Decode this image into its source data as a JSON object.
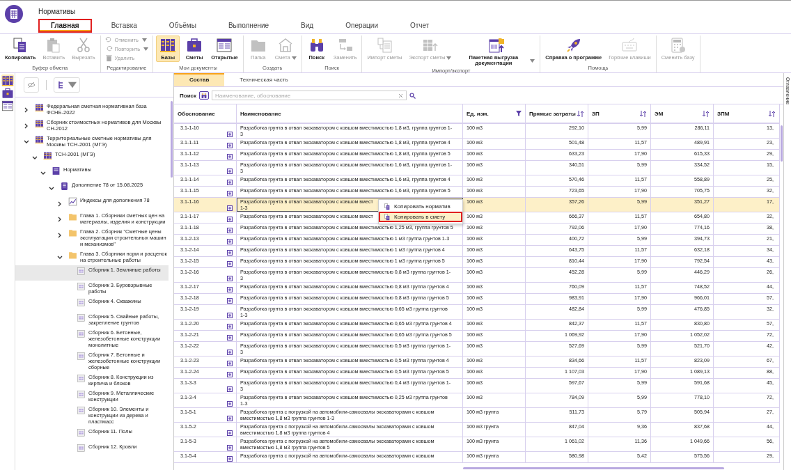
{
  "window": {
    "title": "Нормативы"
  },
  "tabs": [
    {
      "label": "Главная",
      "selected": true
    },
    {
      "label": "Вставка",
      "selected": false
    },
    {
      "label": "Объёмы",
      "selected": false
    },
    {
      "label": "Выполнение",
      "selected": false
    },
    {
      "label": "Вид",
      "selected": false
    },
    {
      "label": "Операции",
      "selected": false
    },
    {
      "label": "Отчет",
      "selected": false
    }
  ],
  "ribbon": [
    {
      "label": "Буфер обмена",
      "items": [
        {
          "label": "Копировать",
          "kind": "large",
          "disabled": false
        },
        {
          "label": "Вставить",
          "kind": "large",
          "disabled": true
        },
        {
          "label": "Вырезать",
          "kind": "large",
          "disabled": true
        }
      ]
    },
    {
      "label": "Редактирование",
      "items": [
        {
          "label": "Отменить",
          "kind": "small",
          "disabled": true,
          "dropdown": true
        },
        {
          "label": "Повторить",
          "kind": "small",
          "disabled": true,
          "dropdown": true
        },
        {
          "label": "Удалить",
          "kind": "small",
          "disabled": true
        }
      ]
    },
    {
      "label": "Мои документы",
      "items": [
        {
          "label": "Базы",
          "kind": "large",
          "disabled": false,
          "selected": true
        },
        {
          "label": "Сметы",
          "kind": "large",
          "disabled": false,
          "selected": false
        },
        {
          "label": "Открытые",
          "kind": "large",
          "disabled": false,
          "selected": false
        }
      ]
    },
    {
      "label": "Создать",
      "items": [
        {
          "label": "Папка",
          "kind": "large",
          "disabled": true
        },
        {
          "label": "Смета",
          "kind": "large",
          "disabled": true,
          "dropdown": true
        }
      ]
    },
    {
      "label": "Поиск",
      "items": [
        {
          "label": "Поиск",
          "kind": "large",
          "disabled": false
        },
        {
          "label": "Заменить",
          "kind": "large",
          "disabled": true
        }
      ]
    },
    {
      "label": "Импорт/экспорт",
      "items": [
        {
          "label": "Импорт сметы",
          "kind": "large",
          "disabled": true
        },
        {
          "label": "Экспорт сметы",
          "kind": "large",
          "disabled": true,
          "dropdown": true
        },
        {
          "label": "Пакетная выгрузка документации",
          "kind": "large",
          "disabled": false,
          "dropdown": true
        }
      ]
    },
    {
      "label": "Помощь",
      "items": [
        {
          "label": "Справка о программе",
          "kind": "large",
          "disabled": false
        },
        {
          "label": "Горячие клавиши",
          "kind": "large",
          "disabled": true
        }
      ]
    },
    {
      "items": [
        {
          "label": "Сменить базу",
          "kind": "large",
          "disabled": true
        }
      ]
    }
  ],
  "side_strip": [
    {
      "selected": true
    },
    {
      "selected": false
    },
    {
      "selected": false
    }
  ],
  "tree": [
    {
      "label": "Федеральная сметная нормативная база ФСНБ-2022",
      "kind": "base",
      "expanded": false,
      "selected": false
    },
    {
      "label": "Сборник стоимостных нормативов для Москвы СН-2012",
      "kind": "base",
      "expanded": false,
      "selected": false
    },
    {
      "label": "Территориальные сметные нормативы для Москвы ТСН-2001 (МГЭ)",
      "kind": "base",
      "expanded": true,
      "selected": false,
      "children": [
        {
          "label": "ТСН-2001 (МГЭ)",
          "kind": "base",
          "expanded": true,
          "selected": false,
          "children": [
            {
              "label": "Нормативы",
              "kind": "norms",
              "expanded": true,
              "selected": false,
              "children": [
                {
                  "label": "Дополнение 78 от 15.08.2025",
                  "kind": "book",
                  "expanded": true,
                  "selected": false,
                  "children": [
                    {
                      "label": "Индексы для дополнения 78",
                      "kind": "chart",
                      "expanded": false,
                      "selected": false
                    },
                    {
                      "label": "Глава 1. Сборники сметных цен на материалы, изделия и конструкции",
                      "kind": "folder",
                      "expanded": false,
                      "selected": false
                    },
                    {
                      "label": "Глава 2. Сборник \"Сметные цены эксплуатации строительных машин и механизмов\"",
                      "kind": "folder",
                      "expanded": false,
                      "selected": false
                    },
                    {
                      "label": "Глава 3. Сборники норм и расценок на строительные работы",
                      "kind": "folder",
                      "expanded": true,
                      "selected": false,
                      "children": [
                        {
                          "label": "Сборник 1. Земляные работы",
                          "kind": "collection",
                          "selected": true
                        },
                        {
                          "label": "Сборник 3. Буровзрывные работы",
                          "kind": "collection",
                          "selected": false
                        },
                        {
                          "label": "Сборник 4. Скважины",
                          "kind": "collection",
                          "selected": false
                        },
                        {
                          "label": "Сборник 5. Свайные работы, закрепление грунтов",
                          "kind": "collection",
                          "selected": false
                        },
                        {
                          "label": "Сборник 6. Бетонные, железобетонные конструкции монолитные",
                          "kind": "collection",
                          "selected": false
                        },
                        {
                          "label": "Сборник 7. Бетонные и железобетонные конструкции сборные",
                          "kind": "collection",
                          "selected": false
                        },
                        {
                          "label": "Сборник 8. Конструкции из кирпича и блоков",
                          "kind": "collection",
                          "selected": false
                        },
                        {
                          "label": "Сборник 9. Металлические конструкции",
                          "kind": "collection",
                          "selected": false
                        },
                        {
                          "label": "Сборник 10. Элементы и конструкции из дерева и пластмасс",
                          "kind": "collection",
                          "selected": false
                        },
                        {
                          "label": "Сборник 11. Полы",
                          "kind": "collection",
                          "selected": false
                        },
                        {
                          "label": "Сборник 12. Кровли",
                          "kind": "collection",
                          "selected": false
                        }
                      ]
                    }
                  ]
                }
              ]
            }
          ]
        }
      ]
    }
  ],
  "content_tabs": [
    {
      "label": "Состав",
      "selected": true
    },
    {
      "label": "Техническая часть",
      "selected": false
    }
  ],
  "search": {
    "label": "Поиск",
    "placeholder": "Наименование, обоснование"
  },
  "right_tab": {
    "label": "Оглавление"
  },
  "table": {
    "columns": [
      {
        "label": "Обоснование",
        "sortable": false,
        "filtered": false
      },
      {
        "label": "Наименование",
        "sortable": false,
        "filtered": false
      },
      {
        "label": "Ед. изм.",
        "sortable": false,
        "filtered": true
      },
      {
        "label": "Прямые затраты",
        "sortable": true,
        "filtered": false
      },
      {
        "label": "ЗП",
        "sortable": true,
        "filtered": false
      },
      {
        "label": "ЭМ",
        "sortable": true,
        "filtered": false
      },
      {
        "label": "ЗПМ",
        "sortable": true,
        "filtered": false
      }
    ],
    "rows": [
      {
        "cells": [
          "3.1-1-10",
          "Разработка грунта в отвал экскаватором с ковшом вместимостью 1,8 м3, группа грунтов 1-3",
          "100 м3",
          "292,10",
          "5,99",
          "286,11",
          "13,"
        ],
        "selected": false
      },
      {
        "cells": [
          "3.1-1-11",
          "Разработка грунта в отвал экскаватором с ковшом вместимостью 1,8 м3, группа грунтов 4",
          "100 м3",
          "501,48",
          "11,57",
          "489,91",
          "23,"
        ],
        "selected": false
      },
      {
        "cells": [
          "3.1-1-12",
          "Разработка грунта в отвал экскаватором с ковшом вместимостью 1,8 м3, группа грунтов 5",
          "100 м3",
          "633,23",
          "17,90",
          "615,33",
          "29,"
        ],
        "selected": false
      },
      {
        "cells": [
          "3.1-1-13",
          "Разработка грунта в отвал экскаватором с ковшом вместимостью 1,6 м3, группа грунтов 1-3",
          "100 м3",
          "340,51",
          "5,99",
          "334,52",
          "15,"
        ],
        "selected": false
      },
      {
        "cells": [
          "3.1-1-14",
          "Разработка грунта в отвал экскаватором с ковшом вместимостью 1,6 м3, группа грунтов 4",
          "100 м3",
          "570,46",
          "11,57",
          "558,89",
          "25,"
        ],
        "selected": false
      },
      {
        "cells": [
          "3.1-1-15",
          "Разработка грунта в отвал экскаватором с ковшом вместимостью 1,6 м3, группа грунтов 5",
          "100 м3",
          "723,65",
          "17,90",
          "705,75",
          "32,"
        ],
        "selected": false
      },
      {
        "cells": [
          "3.1-1-16",
          "Разработка грунта в отвал экскаватором с ковшом вмест\n1-3",
          "100 м3",
          "357,26",
          "5,99",
          "351,27",
          "17,"
        ],
        "selected": true
      },
      {
        "cells": [
          "3.1-1-17",
          "Разработка грунта в отвал экскаватором с ковшом вмест",
          "100 м3",
          "666,37",
          "11,57",
          "654,80",
          "32,"
        ],
        "selected": false
      },
      {
        "cells": [
          "3.1-1-18",
          "Разработка грунта в отвал экскаватором с ковшом вместимостью 1,25 м3, группа грунтов 5",
          "100 м3",
          "792,06",
          "17,90",
          "774,16",
          "38,"
        ],
        "selected": false
      },
      {
        "cells": [
          "3.1-2-13",
          "Разработка грунта в отвал экскаватором с ковшом вместимостью 1 м3 группа грунтов 1-3",
          "100 м3",
          "400,72",
          "5,99",
          "394,73",
          "21,"
        ],
        "selected": false
      },
      {
        "cells": [
          "3.1-2-14",
          "Разработка грунта в отвал экскаватором с ковшом вместимостью 1 м3 группа грунтов 4",
          "100 м3",
          "643,75",
          "11,57",
          "632,18",
          "34,"
        ],
        "selected": false
      },
      {
        "cells": [
          "3.1-2-15",
          "Разработка грунта в отвал экскаватором с ковшом вместимостью 1 м3 группа грунтов 5",
          "100 м3",
          "810,44",
          "17,90",
          "792,54",
          "43,"
        ],
        "selected": false
      },
      {
        "cells": [
          "3.1-2-16",
          "Разработка грунта в отвал экскаватором с ковшом вместимостью 0,8 м3 группа грунтов 1-3",
          "100 м3",
          "452,28",
          "5,99",
          "446,29",
          "26,"
        ],
        "selected": false
      },
      {
        "cells": [
          "3.1-2-17",
          "Разработка грунта в отвал экскаватором с ковшом вместимостью 0,8 м3 группа грунтов 4",
          "100 м3",
          "760,09",
          "11,57",
          "748,52",
          "44,"
        ],
        "selected": false
      },
      {
        "cells": [
          "3.1-2-18",
          "Разработка грунта в отвал экскаватором с ковшом вместимостью 0,8 м3 группа грунтов 5",
          "100 м3",
          "983,91",
          "17,90",
          "966,01",
          "57,"
        ],
        "selected": false
      },
      {
        "cells": [
          "3.1-2-19",
          "Разработка грунта в отвал экскаватором с ковшом вместимостью 0,65 м3 группа грунтов 1-3",
          "100 м3",
          "482,84",
          "5,99",
          "476,85",
          "32,"
        ],
        "selected": false
      },
      {
        "cells": [
          "3.1-2-20",
          "Разработка грунта в отвал экскаватором с ковшом вместимостью 0,65 м3 группа грунтов 4",
          "100 м3",
          "842,37",
          "11,57",
          "830,80",
          "57,"
        ],
        "selected": false
      },
      {
        "cells": [
          "3.1-2-21",
          "Разработка грунта в отвал экскаватором с ковшом вместимостью 0,65 м3 группа грунтов 5",
          "100 м3",
          "1 069,92",
          "17,90",
          "1 052,02",
          "72,"
        ],
        "selected": false
      },
      {
        "cells": [
          "3.1-2-22",
          "Разработка грунта в отвал экскаватором с ковшом вместимостью 0,5 м3 группа грунтов 1-3",
          "100 м3",
          "527,69",
          "5,99",
          "521,70",
          "42,"
        ],
        "selected": false
      },
      {
        "cells": [
          "3.1-2-23",
          "Разработка грунта в отвал экскаватором с ковшом вместимостью 0,5 м3 группа грунтов 4",
          "100 м3",
          "834,66",
          "11,57",
          "823,09",
          "67,"
        ],
        "selected": false
      },
      {
        "cells": [
          "3.1-2-24",
          "Разработка грунта в отвал экскаватором с ковшом вместимостью 0,5 м3 группа грунтов 5",
          "100 м3",
          "1 107,03",
          "17,90",
          "1 089,13",
          "88,"
        ],
        "selected": false
      },
      {
        "cells": [
          "3.1-3-3",
          "Разработка грунта в отвал экскаватором с ковшом вместимостью 0,4 м3 группа грунтов 1-3",
          "100 м3",
          "597,67",
          "5,99",
          "591,68",
          "45,"
        ],
        "selected": false
      },
      {
        "cells": [
          "3.1-3-4",
          "Разработка грунта в отвал экскаватором с ковшом вместимостью 0,25 м3 группа грунтов 1-3",
          "100 м3",
          "784,09",
          "5,99",
          "778,10",
          "72,"
        ],
        "selected": false
      },
      {
        "cells": [
          "3.1-5-1",
          "Разработка грунта с погрузкой на автомобили-самосвалы экскаваторами с ковшом вместимостью 1,8 м3 группа грунтов 1-3",
          "100 м3 грунта",
          "511,73",
          "5,79",
          "505,94",
          "27,"
        ],
        "selected": false
      },
      {
        "cells": [
          "3.1-5-2",
          "Разработка грунта с погрузкой на автомобили-самосвалы экскаваторами с ковшом вместимостью 1,8 м3 группа грунтов 4",
          "100 м3 грунта",
          "847,04",
          "9,36",
          "837,68",
          "44,"
        ],
        "selected": false
      },
      {
        "cells": [
          "3.1-5-3",
          "Разработка грунта с погрузкой на автомобили-самосвалы экскаваторами с ковшом вместимостью 1,8 м3 группа грунтов 5",
          "100 м3 грунта",
          "1 061,02",
          "11,36",
          "1 049,66",
          "56,"
        ],
        "selected": false
      },
      {
        "cells": [
          "3.1-5-4",
          "Разработка грунта с погрузкой на автомобили-самосвалы экскаваторами с ковшом",
          "100 м3 грунта",
          "580,98",
          "5,42",
          "575,56",
          "29,"
        ],
        "selected": false
      }
    ]
  },
  "context_menu": {
    "items": [
      {
        "label": "Копировать норматив",
        "selected": false
      },
      {
        "label": "Копировать в смету",
        "selected": true
      }
    ]
  }
}
